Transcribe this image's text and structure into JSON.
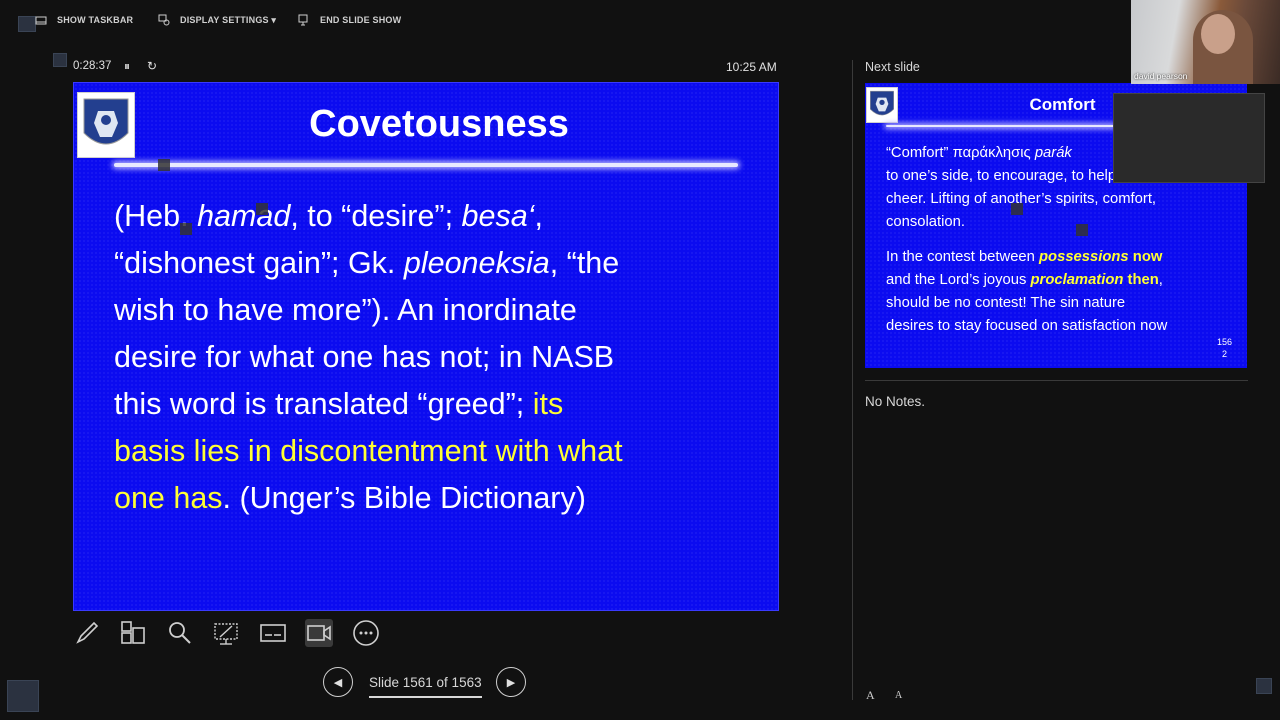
{
  "toolbar": {
    "show_taskbar": "SHOW TASKBAR",
    "display_settings": "DISPLAY SETTINGS ▾",
    "end_slide_show": "END SLIDE SHOW"
  },
  "timer": {
    "elapsed": "0:28:37",
    "pause_icon": "⏸",
    "restart_icon": "↻",
    "clock": "10:25 AM"
  },
  "current_slide": {
    "title": "Covetousness",
    "body_line1_a": "(Heb. ",
    "body_line1_b": "hamad",
    "body_line1_c": ", to “desire”; ",
    "body_line1_d": "besa‘",
    "body_line1_e": ",",
    "body_line2_a": "“dishonest gain”; Gk. ",
    "body_line2_b": "pleoneksia",
    "body_line2_c": ", “the",
    "body_line3": "wish to have more”). An inordinate",
    "body_line4": "desire for what one has not; in NASB",
    "body_line5_a": "this word is translated “greed”; ",
    "body_line5_b": "its",
    "body_line6": "basis lies in discontentment with what",
    "body_line7_a": "one has",
    "body_line7_b": ". (Unger’s Bible Dictionary)"
  },
  "next_slide": {
    "label": "Next slide",
    "title": "Comfort",
    "p1_a": "“Comfort” παράκλησις ",
    "p1_b": "parák",
    "p1_line2": "to one’s side, to encourage, to help, to",
    "p1_line3": "cheer.  Lifting of another’s spirits, comfort,",
    "p1_line4": "consolation.",
    "p2_a": "In the contest between ",
    "p2_b": "possessions",
    "p2_c": " now",
    "p2_line2_a": "and the Lord’s joyous ",
    "p2_line2_b": "proclamation",
    "p2_line2_c": " then",
    "p2_line2_d": ",",
    "p2_line3": "should be no contest! The sin nature",
    "p2_line4": "desires to stay focused on satisfaction now",
    "page_num_1": "156",
    "page_num_2": "2"
  },
  "notes": {
    "text": "No Notes."
  },
  "video": {
    "participant_name": "david pearson"
  },
  "navigation": {
    "slide_indicator": "Slide 1561 of 1563",
    "prev_icon": "◀",
    "next_icon": "▶"
  },
  "font_controls": {
    "increase": "A",
    "decrease": "A"
  },
  "icons": [
    "pen-icon",
    "see-all-slides-icon",
    "zoom-icon",
    "pointer-icon",
    "subtitles-icon",
    "camera-icon",
    "more-options-icon"
  ],
  "colors": {
    "slide_bg": "#0b0bf0",
    "highlight_yellow": "#ffff33",
    "app_bg": "#111111"
  }
}
